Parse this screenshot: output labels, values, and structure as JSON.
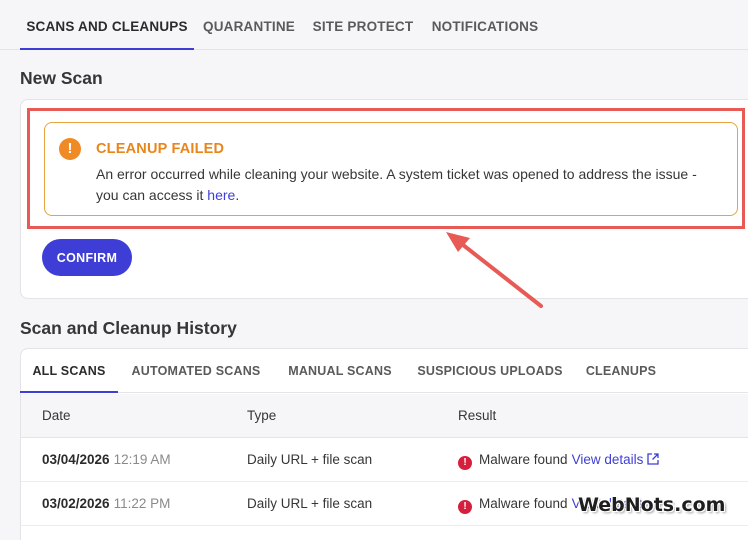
{
  "top_tabs": [
    "SCANS AND CLEANUPS",
    "QUARANTINE",
    "SITE PROTECT",
    "NOTIFICATIONS"
  ],
  "new_scan": {
    "title": "New Scan",
    "alert": {
      "icon": "exclamation-icon",
      "title": "CLEANUP FAILED",
      "message_part1": "An error occurred while cleaning your website. A system ticket was opened to address the issue - you can access it",
      "link": "here",
      "message_end": "."
    },
    "confirm_label": "CONFIRM"
  },
  "history": {
    "title": "Scan and Cleanup History",
    "tabs": [
      "ALL SCANS",
      "AUTOMATED SCANS",
      "MANUAL SCANS",
      "SUSPICIOUS UPLOADS",
      "CLEANUPS"
    ],
    "columns": [
      "Date",
      "Type",
      "Result"
    ],
    "rows": [
      {
        "date": "03/04/2026",
        "time": "12:19 AM",
        "type": "Daily URL + file scan",
        "result": "Malware found",
        "link": "View details"
      },
      {
        "date": "03/02/2026",
        "time": "11:22 PM",
        "type": "Daily URL + file scan",
        "result": "Malware found",
        "link": "View details"
      }
    ]
  },
  "watermark": "WebNots.com",
  "colors": {
    "accent": "#3e3ed6",
    "warning": "#e8a33d",
    "danger": "#d61f3d",
    "highlight": "#e85a55"
  }
}
